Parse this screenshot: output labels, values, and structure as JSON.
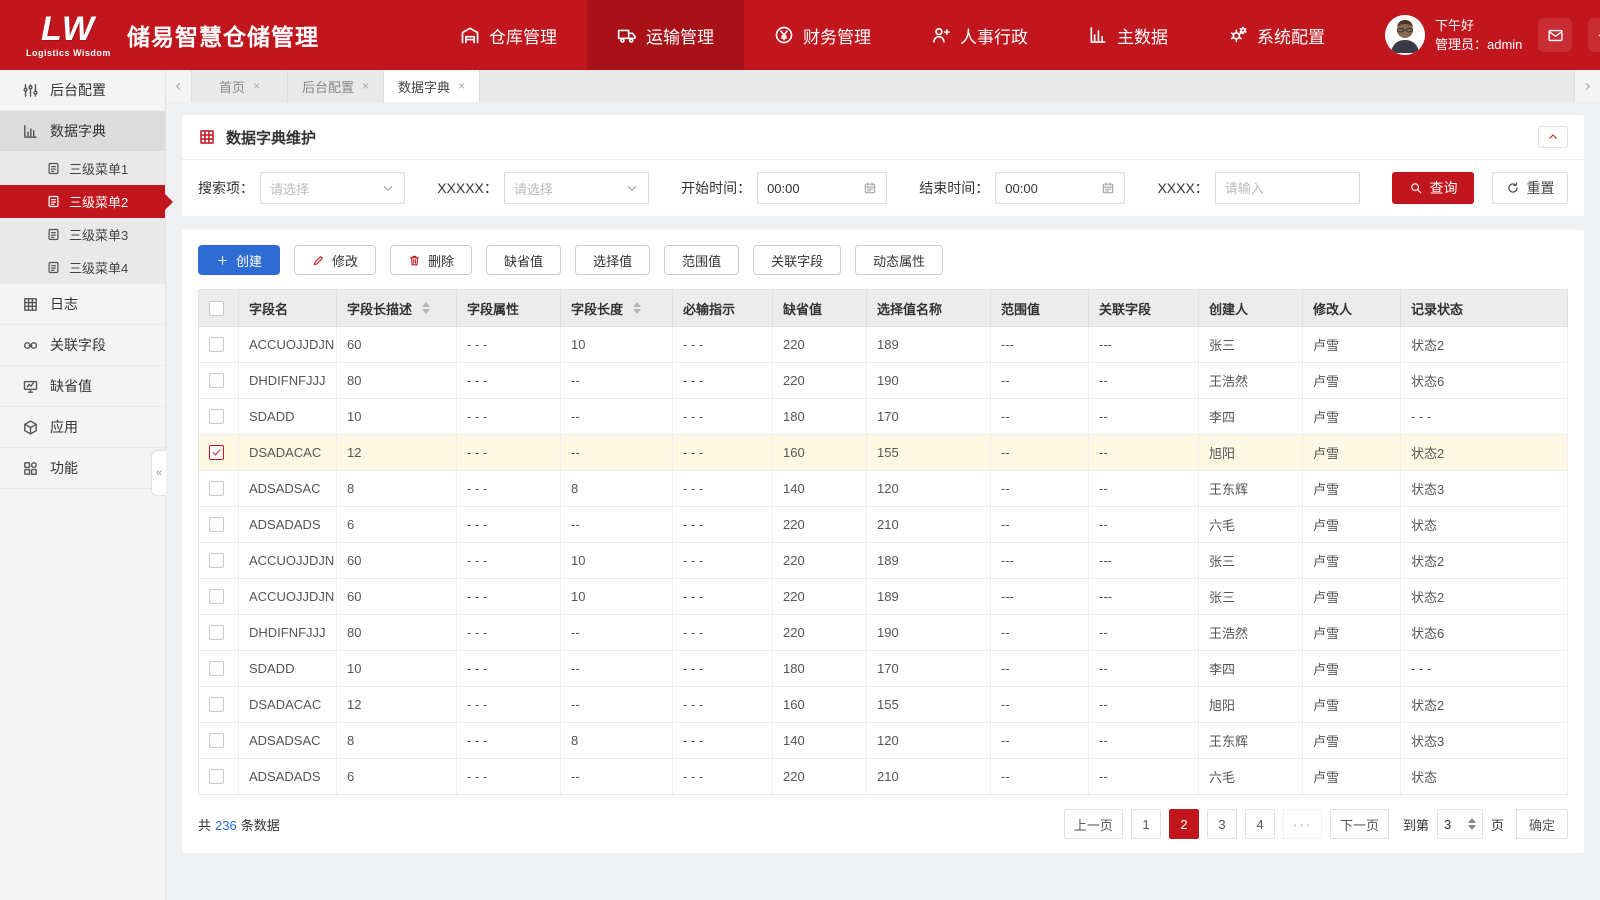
{
  "brand": {
    "logo_main": "LW",
    "logo_sub": "Logistics Wisdom",
    "title": "储易智慧仓储管理"
  },
  "header": {
    "nav": [
      {
        "label": "仓库管理",
        "icon": "warehouse-icon",
        "active": false
      },
      {
        "label": "运输管理",
        "icon": "truck-icon",
        "active": true
      },
      {
        "label": "财务管理",
        "icon": "finance-icon",
        "active": false
      },
      {
        "label": "人事行政",
        "icon": "hr-icon",
        "active": false
      },
      {
        "label": "主数据",
        "icon": "master-data-icon",
        "active": false
      },
      {
        "label": "系统配置",
        "icon": "settings-icon",
        "active": false
      }
    ],
    "greeting": "下午好",
    "user_role": "管理员：admin"
  },
  "tabs": {
    "items": [
      {
        "label": "首页",
        "active": false
      },
      {
        "label": "后台配置",
        "active": false
      },
      {
        "label": "数据字典",
        "active": true
      }
    ]
  },
  "sidebar": {
    "items": [
      {
        "label": "后台配置",
        "icon": "sliders-icon"
      },
      {
        "label": "数据字典",
        "icon": "dict-icon",
        "expanded": true,
        "children": [
          {
            "label": "三级菜单1",
            "active": false
          },
          {
            "label": "三级菜单2",
            "active": true
          },
          {
            "label": "三级菜单3",
            "active": false
          },
          {
            "label": "三级菜单4",
            "active": false
          }
        ]
      },
      {
        "label": "日志",
        "icon": "log-icon"
      },
      {
        "label": "关联字段",
        "icon": "link-icon"
      },
      {
        "label": "缺省值",
        "icon": "default-icon"
      },
      {
        "label": "应用",
        "icon": "app-icon"
      },
      {
        "label": "功能",
        "icon": "function-icon"
      }
    ]
  },
  "page": {
    "title": "数据字典维护"
  },
  "filters": {
    "search_label": "搜索项：",
    "search_placeholder": "请选择",
    "xxxxx_label": "XXXXX：",
    "xxxxx_placeholder": "请选择",
    "start_label": "开始时间：",
    "start_value": "00:00",
    "end_label": "结束时间：",
    "end_value": "00:00",
    "xxxx_label": "XXXX：",
    "xxxx_placeholder": "请输入",
    "query_label": "查询",
    "reset_label": "重置"
  },
  "toolbar": {
    "buttons": [
      {
        "label": "创建",
        "icon": "plus-icon",
        "style": "primary"
      },
      {
        "label": "修改",
        "icon": "pencil-icon",
        "style": "default"
      },
      {
        "label": "删除",
        "icon": "trash-icon",
        "style": "default"
      },
      {
        "label": "缺省值",
        "style": "default"
      },
      {
        "label": "选择值",
        "style": "default"
      },
      {
        "label": "范围值",
        "style": "default"
      },
      {
        "label": "关联字段",
        "style": "default"
      },
      {
        "label": "动态属性",
        "style": "default"
      }
    ]
  },
  "table": {
    "columns": [
      {
        "label": "字段名"
      },
      {
        "label": "字段长描述",
        "sortable": true
      },
      {
        "label": "字段属性"
      },
      {
        "label": "字段长度",
        "sortable": true
      },
      {
        "label": "必输指示"
      },
      {
        "label": "缺省值"
      },
      {
        "label": "选择值名称"
      },
      {
        "label": "范围值"
      },
      {
        "label": "关联字段"
      },
      {
        "label": "创建人"
      },
      {
        "label": "修改人"
      },
      {
        "label": "记录状态"
      }
    ],
    "rows": [
      {
        "checked": false,
        "cells": [
          "ACCUOJJDJN",
          "60",
          "- - -",
          "10",
          "- - -",
          "220",
          "189",
          "---",
          "---",
          "张三",
          "卢雪",
          "状态2"
        ]
      },
      {
        "checked": false,
        "cells": [
          "DHDIFNFJJJ",
          "80",
          "- - -",
          "--",
          "- - -",
          "220",
          "190",
          "--",
          "--",
          "王浩然",
          "卢雪",
          "状态6"
        ]
      },
      {
        "checked": false,
        "cells": [
          "SDADD",
          "10",
          "- - -",
          "--",
          "- - -",
          "180",
          "170",
          "--",
          "--",
          "李四",
          "卢雪",
          "- - -"
        ]
      },
      {
        "checked": true,
        "cells": [
          "DSADACAC",
          "12",
          "- - -",
          "--",
          "- - -",
          "160",
          "155",
          "--",
          "--",
          "旭阳",
          "卢雪",
          "状态2"
        ]
      },
      {
        "checked": false,
        "cells": [
          "ADSADSAC",
          "8",
          "- - -",
          "8",
          "- - -",
          "140",
          "120",
          "--",
          "--",
          "王东辉",
          "卢雪",
          "状态3"
        ]
      },
      {
        "checked": false,
        "cells": [
          "ADSADADS",
          "6",
          "- - -",
          "--",
          "- - -",
          "220",
          "210",
          "--",
          "--",
          "六毛",
          "卢雪",
          "状态"
        ]
      },
      {
        "checked": false,
        "cells": [
          "ACCUOJJDJN",
          "60",
          "- - -",
          "10",
          "- - -",
          "220",
          "189",
          "---",
          "---",
          "张三",
          "卢雪",
          "状态2"
        ]
      },
      {
        "checked": false,
        "cells": [
          "ACCUOJJDJN",
          "60",
          "- - -",
          "10",
          "- - -",
          "220",
          "189",
          "---",
          "---",
          "张三",
          "卢雪",
          "状态2"
        ]
      },
      {
        "checked": false,
        "cells": [
          "DHDIFNFJJJ",
          "80",
          "- - -",
          "--",
          "- - -",
          "220",
          "190",
          "--",
          "--",
          "王浩然",
          "卢雪",
          "状态6"
        ]
      },
      {
        "checked": false,
        "cells": [
          "SDADD",
          "10",
          "- - -",
          "--",
          "- - -",
          "180",
          "170",
          "--",
          "--",
          "李四",
          "卢雪",
          "- - -"
        ]
      },
      {
        "checked": false,
        "cells": [
          "DSADACAC",
          "12",
          "- - -",
          "--",
          "- - -",
          "160",
          "155",
          "--",
          "--",
          "旭阳",
          "卢雪",
          "状态2"
        ]
      },
      {
        "checked": false,
        "cells": [
          "ADSADSAC",
          "8",
          "- - -",
          "8",
          "- - -",
          "140",
          "120",
          "--",
          "--",
          "王东辉",
          "卢雪",
          "状态3"
        ]
      },
      {
        "checked": false,
        "cells": [
          "ADSADADS",
          "6",
          "- - -",
          "--",
          "- - -",
          "220",
          "210",
          "--",
          "--",
          "六毛",
          "卢雪",
          "状态"
        ]
      }
    ]
  },
  "pagination": {
    "total_prefix": "共",
    "total_count": "236",
    "total_suffix": "条数据",
    "prev_label": "上一页",
    "next_label": "下一页",
    "pages": [
      "1",
      "2",
      "3",
      "4",
      "···"
    ],
    "active_page": "2",
    "goto_prefix": "到第",
    "goto_value": "3",
    "goto_suffix": "页",
    "confirm_label": "确定"
  },
  "colors": {
    "brand_red": "#c2161e",
    "nav_active_red": "#a81118",
    "primary_blue": "#2e6bd2",
    "selected_row": "#fdf8e3",
    "link_blue": "#2e6bd2"
  }
}
